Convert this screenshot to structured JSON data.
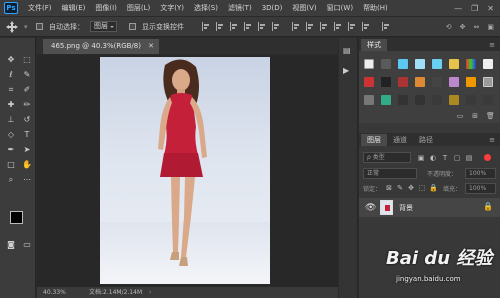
{
  "app": {
    "logo": "Ps"
  },
  "menu": [
    "文件(F)",
    "编辑(E)",
    "图像(I)",
    "图层(L)",
    "文字(Y)",
    "选择(S)",
    "滤镜(T)",
    "3D(D)",
    "视图(V)",
    "窗口(W)",
    "帮助(H)"
  ],
  "window_controls": {
    "minimize": "—",
    "restore": "❐",
    "close": "✕"
  },
  "options_bar": {
    "auto_select_label": "自动选择：",
    "auto_select_value": "图层",
    "show_transform_label": "显示变换控件"
  },
  "document": {
    "tab_title": "465.png @ 40.3%(RGB/8)",
    "tab_close": "✕",
    "zoom": "40.33%",
    "doc_size": "文档:2.14M/2.14M"
  },
  "swatches_panel": {
    "tab": "样式"
  },
  "layers_panel": {
    "tabs": [
      "图层",
      "通道",
      "路径"
    ],
    "search_placeholder": "ρ 类型",
    "blend_mode": "正常",
    "opacity_label": "不透明度：",
    "opacity_value": "100%",
    "lock_label": "锁定：",
    "fill_label": "填充：",
    "fill_value": "100%",
    "layer_name": "背景"
  },
  "watermark": {
    "text": "Bai du 经验",
    "sub": "jingyan.baidu.com"
  },
  "colors": {
    "accent": "#31a8ff",
    "dress": "#c4203a",
    "panel": "#383838",
    "canvas_bg": "#282828"
  }
}
